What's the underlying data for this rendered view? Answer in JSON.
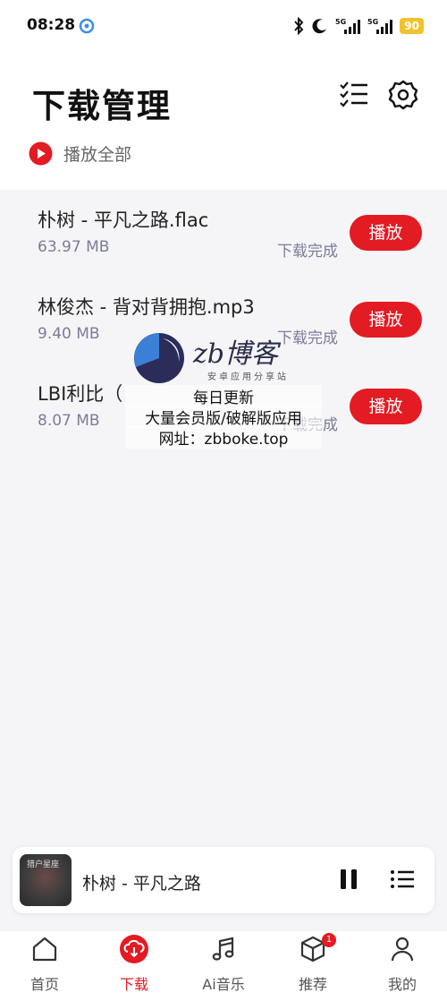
{
  "status_bar": {
    "time": "08:28",
    "battery": "90",
    "network": "5G"
  },
  "header": {
    "title": "下载管理",
    "play_all_label": "播放全部"
  },
  "tracks": [
    {
      "title": "朴树 - 平凡之路.flac",
      "size": "63.97 MB",
      "status": "下载完成",
      "play_label": "播放"
    },
    {
      "title": "林俊杰 - 背对背拥抱.mp3",
      "size": "9.40 MB",
      "status": "下载完成",
      "play_label": "播放"
    },
    {
      "title": "LBI利比（",
      "size": "8.07 MB",
      "status": "下载完成",
      "play_label": "播放"
    }
  ],
  "watermark": {
    "brand": "zb博客",
    "tagline": "安卓应用分享站",
    "lines": [
      "每日更新",
      "大量会员版/破解版应用",
      "网址：zbboke.top"
    ]
  },
  "mini_player": {
    "title": "朴树 - 平凡之路",
    "cover_text": "猎户星座"
  },
  "nav": {
    "items": [
      {
        "label": "首页",
        "icon": "home-icon"
      },
      {
        "label": "下载",
        "icon": "download-cloud-icon"
      },
      {
        "label": "Ai音乐",
        "icon": "music-note-icon"
      },
      {
        "label": "推荐",
        "icon": "cube-icon",
        "badge": "1"
      },
      {
        "label": "我的",
        "icon": "person-icon"
      }
    ]
  },
  "colors": {
    "accent": "#e31b23",
    "secondary_text": "#7a7d99",
    "background": "#f5f5f7"
  }
}
